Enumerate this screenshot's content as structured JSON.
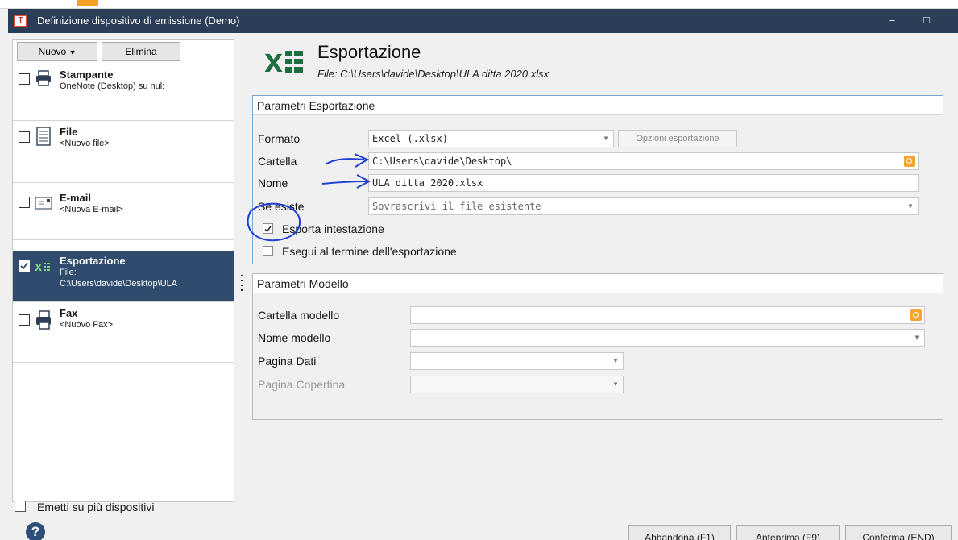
{
  "window": {
    "title": "Definizione dispositivo di emissione (Demo)",
    "app_icon_letter": "T",
    "minimize_glyph": "–",
    "maximize_glyph": "□"
  },
  "toolbar": {
    "new_label": "Nuovo",
    "new_accel": "N",
    "new_rest": "uovo",
    "delete_label": "Elimina",
    "delete_accel": "E",
    "delete_rest": "limina"
  },
  "devices": [
    {
      "name": "Stampante",
      "sub": "OneNote (Desktop) su nul:",
      "icon": "printer-icon",
      "checked": false,
      "selected": false
    },
    {
      "name": "File",
      "sub": "<Nuovo file>",
      "icon": "file-icon",
      "checked": false,
      "selected": false
    },
    {
      "name": "E-mail",
      "sub": "<Nuova E-mail>",
      "icon": "email-icon",
      "checked": false,
      "selected": false
    },
    {
      "name": "Esportazione",
      "sub": "File:",
      "sub2": "C:\\Users\\davide\\Desktop\\ULA",
      "icon": "excel-icon",
      "checked": true,
      "selected": true
    },
    {
      "name": "Fax",
      "sub": "<Nuovo Fax>",
      "icon": "fax-icon",
      "checked": false,
      "selected": false
    }
  ],
  "multi_device_label": "Emetti su più dispositivi",
  "header": {
    "title": "Esportazione",
    "file_line": "File: C:\\Users\\davide\\Desktop\\ULA ditta 2020.xlsx"
  },
  "export_params": {
    "group_title": "Parametri Esportazione",
    "format_label": "Formato",
    "format_value": "Excel (.xlsx)",
    "options_button": "Opzioni esportazione",
    "folder_label": "Cartella",
    "folder_value": "C:\\Users\\davide\\Desktop\\",
    "name_label": "Nome",
    "name_value": "ULA ditta 2020.xlsx",
    "exists_label": "Se esiste",
    "exists_value": "Sovrascrivi il file esistente",
    "export_header_label": "Esporta intestazione",
    "export_header_checked": true,
    "run_after_label": "Esegui al termine dell'esportazione",
    "run_after_checked": false
  },
  "model_params": {
    "group_title": "Parametri Modello",
    "folder_label": "Cartella modello",
    "folder_value": "",
    "name_label": "Nome modello",
    "name_value": "",
    "data_page_label": "Pagina Dati",
    "data_page_value": "",
    "cover_page_label": "Pagina Copertina",
    "cover_page_value": ""
  },
  "footer": {
    "cancel_label": "Abbandona (F1)",
    "preview_label": "Anteprima (F9)",
    "confirm_label": "Conferma (END)"
  },
  "colors": {
    "titlebar": "#2b3d57",
    "selection": "#2f4b6e",
    "excel_green": "#1d6f42",
    "ink_blue": "#1e3fd1"
  }
}
